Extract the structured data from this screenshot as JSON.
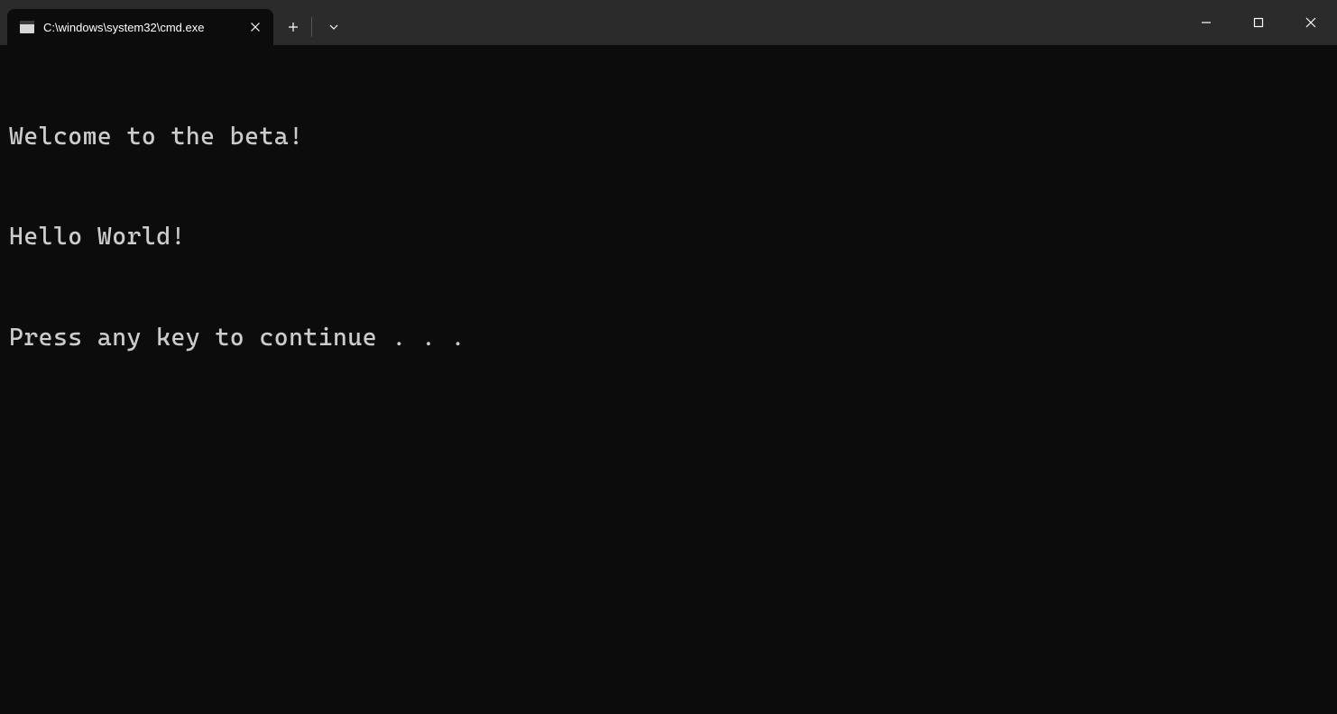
{
  "titlebar": {
    "tab": {
      "title": "C:\\windows\\system32\\cmd.exe",
      "icon": "cmd-icon"
    }
  },
  "terminal": {
    "lines": [
      "Welcome to the beta!",
      "Hello World!",
      "Press any key to continue . . ."
    ]
  }
}
